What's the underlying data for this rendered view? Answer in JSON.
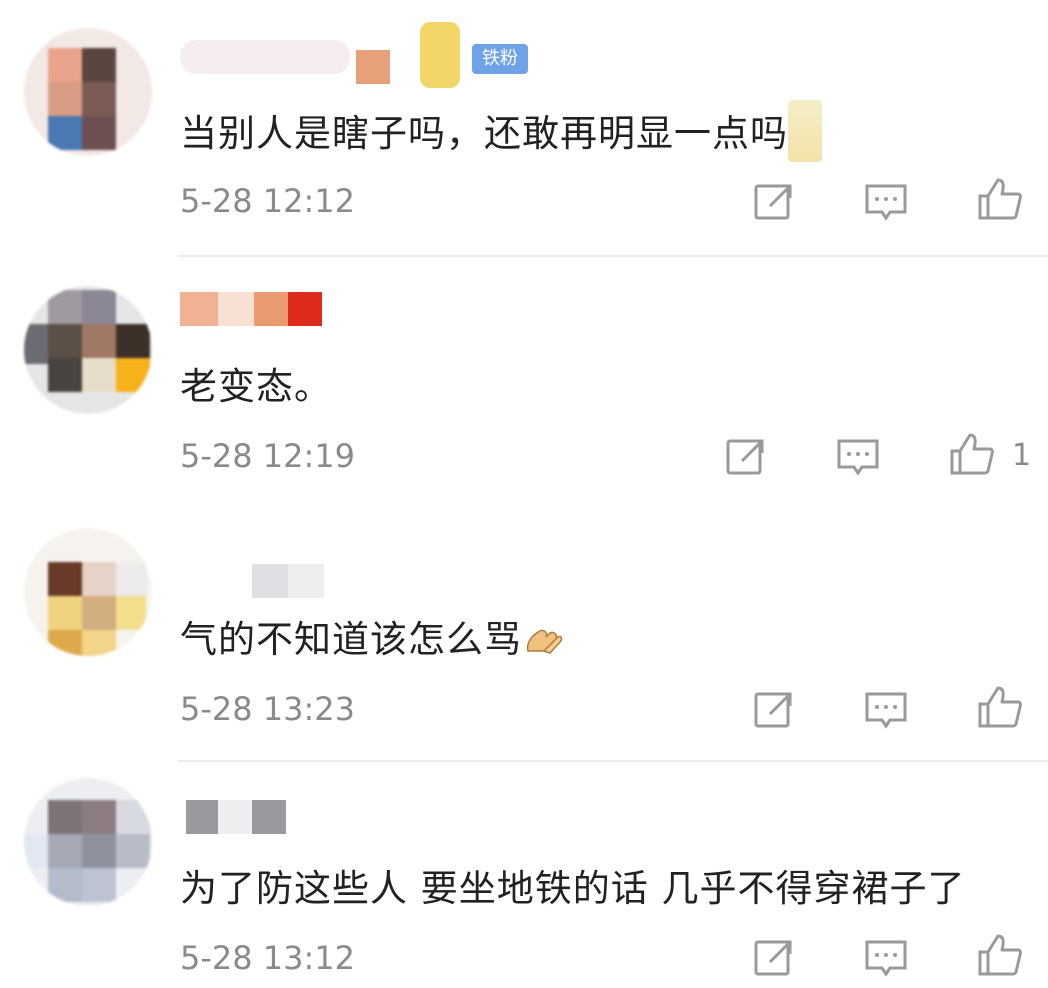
{
  "comments": [
    {
      "badge": "铁粉",
      "text": "当别人是瞎子吗，还敢再明显一点吗",
      "time": "5-28 12:12",
      "likes": ""
    },
    {
      "text": "老变态。",
      "time": "5-28 12:19",
      "likes": "1"
    },
    {
      "text": "气的不知道该怎么骂",
      "time": "5-28 13:23",
      "likes": ""
    },
    {
      "text": "为了防这些人 要坐地铁的话 几乎不得穿裙子了",
      "time": "5-28 13:12",
      "likes": ""
    }
  ],
  "icons": {
    "share": "share-icon",
    "comment": "comment-icon",
    "like": "thumbs-up-icon"
  },
  "colors": {
    "text": "#222222",
    "time": "#8a8a8a",
    "badge": "#6fa3e8"
  }
}
